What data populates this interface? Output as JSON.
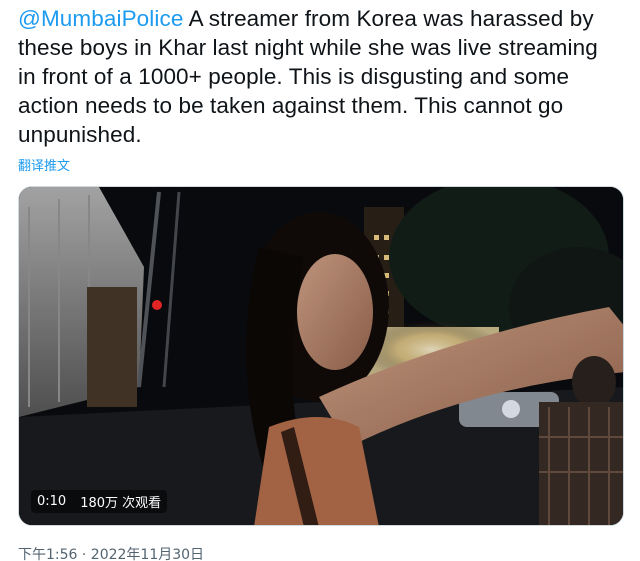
{
  "tweet": {
    "mention": "@MumbaiPolice",
    "text": " A streamer from Korea was harassed by these boys in Khar last night while she was live streaming in front of a 1000+ people. This is disgusting and some action needs to be taken against them. This cannot go unpunished.",
    "translate_label": "翻译推文",
    "timestamp": "下午1:56 · 2022年11月30日"
  },
  "video": {
    "duration": "0:10",
    "views": "180万 次观看"
  },
  "colors": {
    "link": "#1d9bf0",
    "text": "#0f1419",
    "secondary": "#536471"
  }
}
